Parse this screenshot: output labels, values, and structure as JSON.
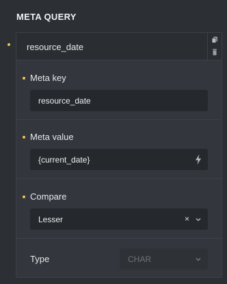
{
  "panel": {
    "title": "META QUERY"
  },
  "query_item": {
    "title": "resource_date",
    "actions": [
      {
        "icon": "copy-icon"
      },
      {
        "icon": "trash-icon"
      }
    ]
  },
  "meta_key": {
    "label": "Meta key",
    "value": "resource_date"
  },
  "meta_value": {
    "label": "Meta value",
    "value": "{current_date}",
    "icon": "bolt-icon"
  },
  "compare": {
    "label": "Compare",
    "value": "Lesser",
    "clear_glyph": "×"
  },
  "type": {
    "label": "Type",
    "value": "CHAR"
  },
  "colors": {
    "accent_dot": "#f3c44b"
  }
}
